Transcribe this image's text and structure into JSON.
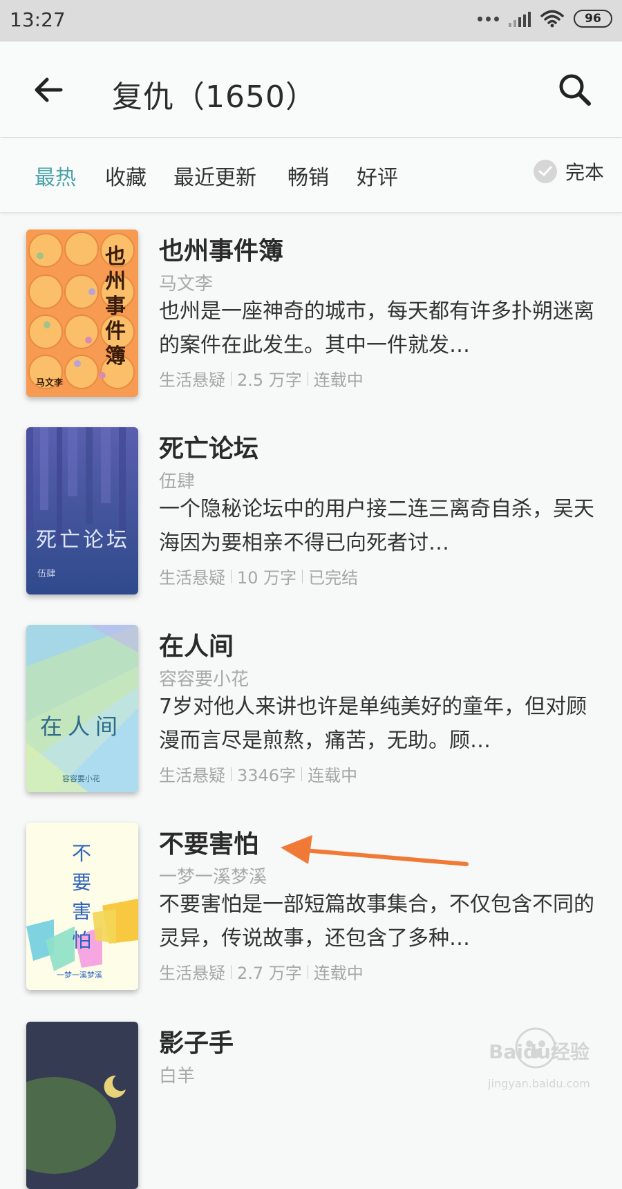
{
  "status_bar": {
    "time": "13:27",
    "battery": "96"
  },
  "header": {
    "title": "复仇（1650）"
  },
  "filters": {
    "tabs": [
      {
        "label": "最热",
        "active": true
      },
      {
        "label": "收藏",
        "active": false
      },
      {
        "label": "最近更新",
        "active": false
      },
      {
        "label": "畅销",
        "active": false
      },
      {
        "label": "好评",
        "active": false
      }
    ],
    "complete_label": "完本"
  },
  "books": [
    {
      "title": "也州事件簿",
      "author": "马文李",
      "description": "也州是一座神奇的城市，每天都有许多扑朔迷离的案件在此发生。其中一件就发…",
      "category": "生活悬疑",
      "words": "2.5 万字",
      "status": "连载中",
      "cover_title": "也州事件簿",
      "cover_author": "马文李"
    },
    {
      "title": "死亡论坛",
      "author": "伍肆",
      "description": "一个隐秘论坛中的用户接二连三离奇自杀，吴天海因为要相亲不得已向死者讨…",
      "category": "生活悬疑",
      "words": "10 万字",
      "status": "已完结",
      "cover_title": "死亡论坛",
      "cover_author": "伍肆"
    },
    {
      "title": "在人间",
      "author": "容容要小花",
      "description": "7岁对他人来讲也许是单纯美好的童年，但对顾漫而言尽是煎熬，痛苦，无助。顾…",
      "category": "生活悬疑",
      "words": "3346字",
      "status": "连载中",
      "cover_title": "在人间",
      "cover_author": "容容要小花"
    },
    {
      "title": "不要害怕",
      "author": "一梦一溪梦溪",
      "description": "不要害怕是一部短篇故事集合，不仅包含不同的灵异，传说故事，还包含了多种…",
      "category": "生活悬疑",
      "words": "2.7 万字",
      "status": "连载中",
      "cover_title": "不要害怕",
      "cover_author": "一梦一溪梦溪"
    },
    {
      "title": "影子手",
      "author": "白羊"
    }
  ],
  "watermark": {
    "brand": "Baidu经验",
    "url": "jingyan.baidu.com"
  },
  "colors": {
    "accent": "#4aa3a8",
    "annotation_arrow": "#f07a35"
  }
}
